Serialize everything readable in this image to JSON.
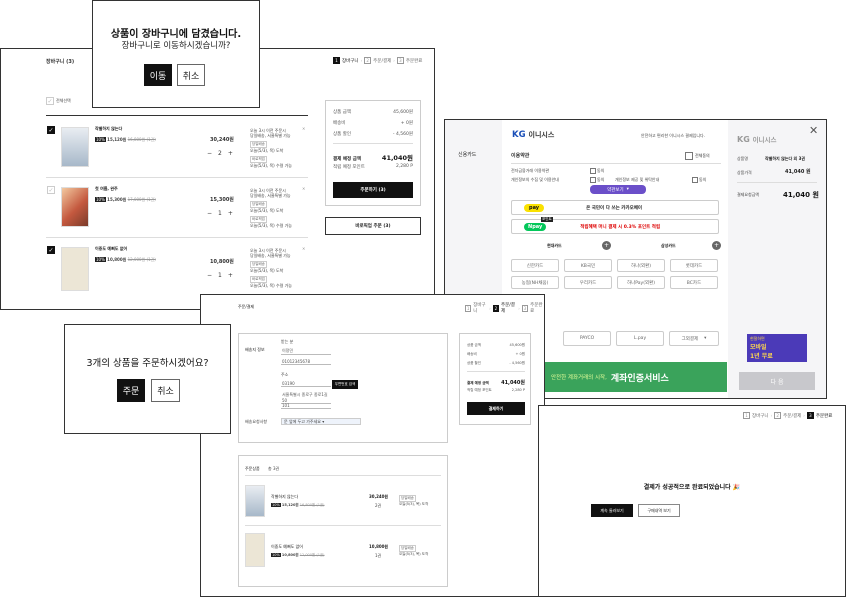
{
  "colors": {
    "accent_dark": "#111111",
    "kakao_yellow": "#fae100",
    "naver_green": "#03c75a",
    "inicis_blue": "#1a4fb8",
    "banner_green": "#3aa35b",
    "purple": "#6b4fc9"
  },
  "cart": {
    "title": "장바구니 (3)",
    "steps": [
      {
        "num": "1",
        "label": "장바구니"
      },
      {
        "num": "2",
        "label": "주문/결제"
      },
      {
        "num": "3",
        "label": "주문완료"
      }
    ],
    "select_all": "전체선택",
    "items": [
      {
        "title": "작별하지 않는다",
        "badge": "10%",
        "price": "15,120원",
        "orig": "16,800원 (1권)",
        "total": "30,240원",
        "qty": "2",
        "delivery": "오늘 3시 이전 주문시",
        "delivery2": "당일배송, 서울특별 가능",
        "tag": "당일배송",
        "loc": "오늘(5/3), 목) 도착",
        "tag2": "바로픽업",
        "loc2": "오늘(5/3), 목) 수령 가능"
      },
      {
        "title": "첫 여름, 완주",
        "badge": "10%",
        "price": "15,300원",
        "orig": "17,000원 (1권)",
        "total": "15,300원",
        "qty": "1",
        "delivery": "오늘 3시 이전 주문시",
        "delivery2": "당일배송, 서울특별 가능",
        "tag": "당일배송",
        "loc": "오늘(5/3), 목) 도착",
        "tag2": "바로픽업",
        "loc2": "오늘(5/3), 목) 수령 가능"
      },
      {
        "title": "이중도 예뻐도 없어",
        "badge": "10%",
        "price": "10,800원",
        "orig": "12,000원 (1권)",
        "total": "10,800원",
        "qty": "1",
        "delivery": "오늘 3시 이전 주문시",
        "delivery2": "당일배송, 서울특별 가능",
        "tag": "당일배송",
        "loc": "오늘(5/3), 목) 도착",
        "tag2": "바로픽업",
        "loc2": "오늘(5/3), 목) 수령 가능"
      }
    ],
    "summary": {
      "product_amount_label": "상품 금액",
      "product_amount": "45,600원",
      "shipping_label": "배송비",
      "shipping": "+ 0원",
      "discount_label": "상품 할인",
      "discount": "- 4,560원",
      "pay_label": "결제 예정 금액",
      "pay": "41,040원",
      "points_label": "적립 예정 포인트",
      "points": "2,280 P",
      "order_button": "주문하기 (3)",
      "pickup_button": "바로픽업 주문 (3)"
    }
  },
  "dialog_cart": {
    "title": "상품이 장바구니에 담겼습니다.",
    "subtitle": "장바구니로 이동하시겠습니까?",
    "confirm": "이동",
    "cancel": "취소"
  },
  "inicis": {
    "logo_kg": "KG",
    "logo_name": "이니시스",
    "tagline": "안전하고 편리한 이니시스 결제입니다.",
    "method": "신용카드",
    "terms_title": "이용약관",
    "agree_all": "전체동의",
    "terms": [
      {
        "label": "전자금융거래 이용약관",
        "agree": "동의"
      },
      {
        "label": "개인정보의 수집 및 이용안내",
        "agree": "동의",
        "label2": "개인정보 제공 및 위탁안내",
        "agree2": "동의"
      }
    ],
    "view_terms": "약관보기",
    "kakaopay_logo": "pay",
    "kakaopay_text": "온 국민이 다 쓰는 카카오페이",
    "npay_logo": "pay",
    "npay_badge": "포인트",
    "npay_text": "적립혜택 머니 결제 시 0.3% 포인트 적립",
    "card_tabs": [
      "현대카드",
      "삼성카드"
    ],
    "cards": [
      "신한카드",
      "KB국민",
      "하나(외환)",
      "롯데카드",
      "농협(NH채움)",
      "우리카드",
      "하나Pay(외환)",
      "BC카드"
    ],
    "pay_methods": [
      "PAYCO",
      "L.pay",
      "그외결제"
    ],
    "banner_text": "안전한 계좌거래의 시작,",
    "banner_strong": "계좌인증서비스",
    "side_logo_kg": "KG",
    "side_logo_name": "이니시스",
    "product_label": "상품명",
    "product_value": "작별하지 않는다 외 3권",
    "price_label": "상품가격",
    "price_value": "41,040 원",
    "pay_label": "결제요청금액",
    "pay_value": "41,040 원",
    "ad_line1": "현절하면",
    "ad_line2": "모바일",
    "ad_line3": "1년 무료",
    "next_button": "다 음",
    "close": "✕"
  },
  "order": {
    "title": "주문/결제",
    "steps": [
      {
        "num": "1",
        "label": "장바구니"
      },
      {
        "num": "2",
        "label": "주문/결제"
      },
      {
        "num": "3",
        "label": "주문완료"
      }
    ],
    "shipping_title": "배송지 정보",
    "name_label": "받는 분",
    "name": "이정민",
    "phone": "01012345678",
    "addr_label": "주소",
    "zip": "03190",
    "zip_button": "우편번호 검색",
    "addr1": "서울특별시 종로구 종로1길 50",
    "addr2": "101",
    "req_label": "배송요청사항",
    "req": "문 앞에 두고 가주세요 ▾",
    "products_title": "주문상품",
    "products_count": "총 3권",
    "items": [
      {
        "title": "작별하지 않는다",
        "badge": "10%",
        "price": "15,120원",
        "orig": "16,800원 (1권)",
        "total": "30,240원",
        "qty": "2권",
        "tag": "당일배송",
        "loc": "오늘(5/3), 목) 도착"
      },
      {
        "title": "이중도 예뻐도 없어",
        "badge": "10%",
        "price": "10,800원",
        "orig": "12,000원 (1권)",
        "total": "10,800원",
        "qty": "1권",
        "tag": "당일배송",
        "loc": "오늘(5/3), 목) 도착"
      }
    ],
    "summary": {
      "product_amount_label": "상품 금액",
      "product_amount": "45,600원",
      "shipping_label": "배송비",
      "shipping": "+ 0원",
      "discount_label": "상품 할인",
      "discount": "- 4,560원",
      "pay_label": "결제 예정 금액",
      "pay": "41,040원",
      "points_label": "적립 예정 포인트",
      "points": "2,280 P",
      "pay_button": "결제하기"
    }
  },
  "dialog_order": {
    "title": "3개의 상품을 주문하시겠어요?",
    "confirm": "주문",
    "cancel": "취소"
  },
  "complete": {
    "steps": [
      {
        "num": "1",
        "label": "장바구니"
      },
      {
        "num": "2",
        "label": "주문/결제"
      },
      {
        "num": "3",
        "label": "주문완료"
      }
    ],
    "message": "결제가 성공적으로 완료되었습니다",
    "emoji": "🎉",
    "continue_button": "계속 둘러보기",
    "history_button": "구매내역 보기"
  }
}
